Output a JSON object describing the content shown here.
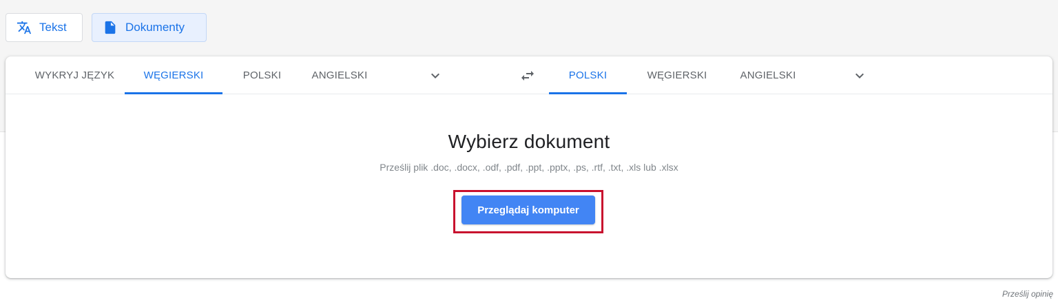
{
  "mode_tabs": {
    "text_label": "Tekst",
    "documents_label": "Dokumenty",
    "active": "documents"
  },
  "source_languages": [
    {
      "label": "WYKRYJ JĘZYK",
      "selected": false
    },
    {
      "label": "WĘGIERSKI",
      "selected": true
    },
    {
      "label": "POLSKI",
      "selected": false
    },
    {
      "label": "ANGIELSKI",
      "selected": false
    }
  ],
  "target_languages": [
    {
      "label": "POLSKI",
      "selected": true
    },
    {
      "label": "WĘGIERSKI",
      "selected": false
    },
    {
      "label": "ANGIELSKI",
      "selected": false
    }
  ],
  "document": {
    "title": "Wybierz dokument",
    "subtitle": "Prześlij plik .doc, .docx, .odf, .pdf, .ppt, .pptx, .ps, .rtf, .txt, .xls lub .xlsx",
    "browse_label": "Przeglądaj komputer"
  },
  "feedback_label": "Prześlij opinię",
  "colors": {
    "accent": "#1a73e8",
    "button": "#4285f4",
    "highlight": "#c8102e"
  },
  "icons": {
    "text_mode": "translate-icon",
    "documents_mode": "document-icon",
    "swap": "swap-icon",
    "more": "chevron-down-icon"
  }
}
